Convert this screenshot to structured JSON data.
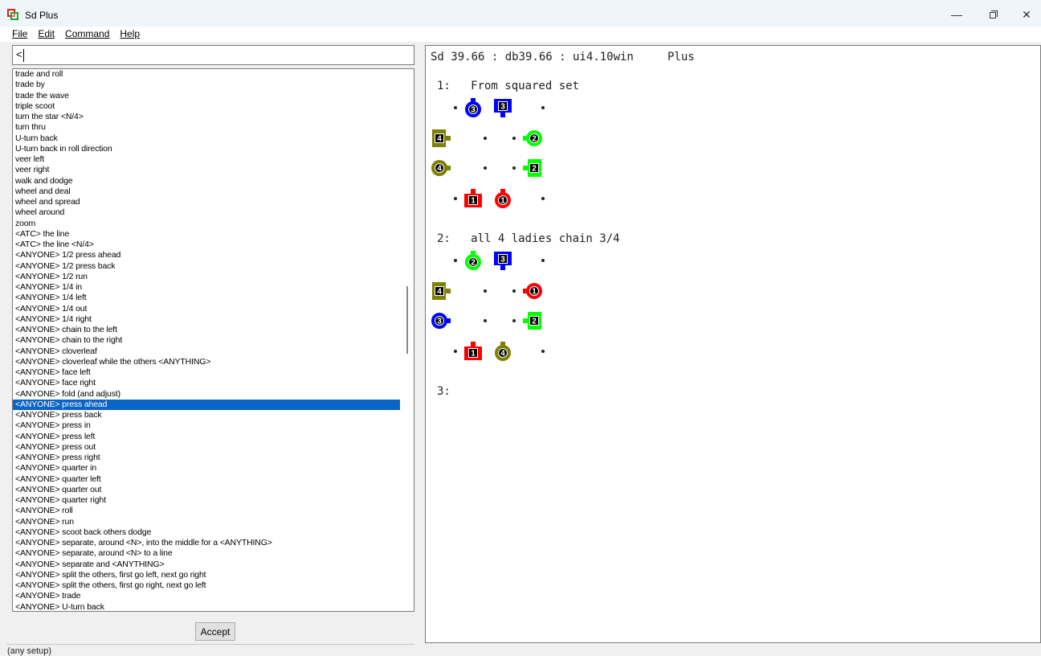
{
  "window": {
    "title": "Sd Plus"
  },
  "menu": {
    "file": "File",
    "edit": "Edit",
    "command": "Command",
    "help": "Help"
  },
  "command_input": {
    "value": "<"
  },
  "call_list": {
    "items": [
      "trade and roll",
      "trade by",
      "trade the wave",
      "triple scoot",
      "turn the star <N/4>",
      "turn thru",
      "U-turn back",
      "U-turn back in roll direction",
      "veer left",
      "veer right",
      "walk and dodge",
      "wheel and deal",
      "wheel and spread",
      "wheel around",
      "zoom",
      "<ATC> the line",
      "<ATC> the line <N/4>",
      "<ANYONE> 1/2 press ahead",
      "<ANYONE> 1/2 press back",
      "<ANYONE> 1/2 run",
      "<ANYONE> 1/4 in",
      "<ANYONE> 1/4 left",
      "<ANYONE> 1/4 out",
      "<ANYONE> 1/4 right",
      "<ANYONE> chain to the left",
      "<ANYONE> chain to the right",
      "<ANYONE> cloverleaf",
      "<ANYONE> cloverleaf while the others <ANYTHING>",
      "<ANYONE> face left",
      "<ANYONE> face right",
      "<ANYONE> fold (and adjust)",
      "<ANYONE> press ahead",
      "<ANYONE> press back",
      "<ANYONE> press in",
      "<ANYONE> press left",
      "<ANYONE> press out",
      "<ANYONE> press right",
      "<ANYONE> quarter in",
      "<ANYONE> quarter left",
      "<ANYONE> quarter out",
      "<ANYONE> quarter right",
      "<ANYONE> roll",
      "<ANYONE> run",
      "<ANYONE> scoot back others dodge",
      "<ANYONE> separate, around <N>, into the middle for a <ANYTHING>",
      "<ANYONE> separate, around <N> to a line",
      "<ANYONE> separate and <ANYTHING>",
      "<ANYONE> split the others, first go left, next go right",
      "<ANYONE> split the others, first go right, next go left",
      "<ANYONE> trade",
      "<ANYONE> U-turn back"
    ],
    "selected_index": 31
  },
  "accept_button": "Accept",
  "status": "(any setup)",
  "output": {
    "header": "Sd 39.66 : db39.66 : ui4.10win     Plus",
    "entries": [
      {
        "label": "1:   From squared set",
        "rows": [
          [
            {
              "type": "dot"
            },
            {
              "shape": "girl",
              "num": "3",
              "color": "#0000ff",
              "dir": "up"
            },
            {
              "shape": "boy",
              "num": "3",
              "color": "#0000ff",
              "dir": "down"
            },
            {
              "type": "dot"
            }
          ],
          [
            {
              "shape": "boy",
              "num": "4",
              "color": "#7f7f00",
              "dir": "right"
            },
            {
              "type": "dot"
            },
            {
              "type": "dot"
            },
            {
              "shape": "girl",
              "num": "2",
              "color": "#00ff00",
              "dir": "left"
            }
          ],
          [
            {
              "shape": "girl",
              "num": "4",
              "color": "#7f7f00",
              "dir": "right"
            },
            {
              "type": "dot"
            },
            {
              "type": "dot"
            },
            {
              "shape": "boy",
              "num": "2",
              "color": "#00ff00",
              "dir": "left"
            }
          ],
          [
            {
              "type": "dot"
            },
            {
              "shape": "boy",
              "num": "1",
              "color": "#ff0000",
              "dir": "up"
            },
            {
              "shape": "girl",
              "num": "1",
              "color": "#ff0000",
              "dir": "up"
            },
            {
              "type": "dot"
            }
          ]
        ]
      },
      {
        "label": "2:   all 4 ladies chain 3/4",
        "rows": [
          [
            {
              "type": "dot"
            },
            {
              "shape": "girl",
              "num": "2",
              "color": "#00ff00",
              "dir": "up"
            },
            {
              "shape": "boy",
              "num": "3",
              "color": "#0000ff",
              "dir": "down"
            },
            {
              "type": "dot"
            }
          ],
          [
            {
              "shape": "boy",
              "num": "4",
              "color": "#7f7f00",
              "dir": "right"
            },
            {
              "type": "dot"
            },
            {
              "type": "dot"
            },
            {
              "shape": "girl",
              "num": "1",
              "color": "#ff0000",
              "dir": "left"
            }
          ],
          [
            {
              "shape": "girl",
              "num": "3",
              "color": "#0000ff",
              "dir": "right"
            },
            {
              "type": "dot"
            },
            {
              "type": "dot"
            },
            {
              "shape": "boy",
              "num": "2",
              "color": "#00ff00",
              "dir": "left"
            }
          ],
          [
            {
              "type": "dot"
            },
            {
              "shape": "boy",
              "num": "1",
              "color": "#ff0000",
              "dir": "up"
            },
            {
              "shape": "girl",
              "num": "4",
              "color": "#7f7f00",
              "dir": "up"
            },
            {
              "type": "dot"
            }
          ]
        ]
      },
      {
        "label": "3:",
        "rows": []
      }
    ]
  }
}
